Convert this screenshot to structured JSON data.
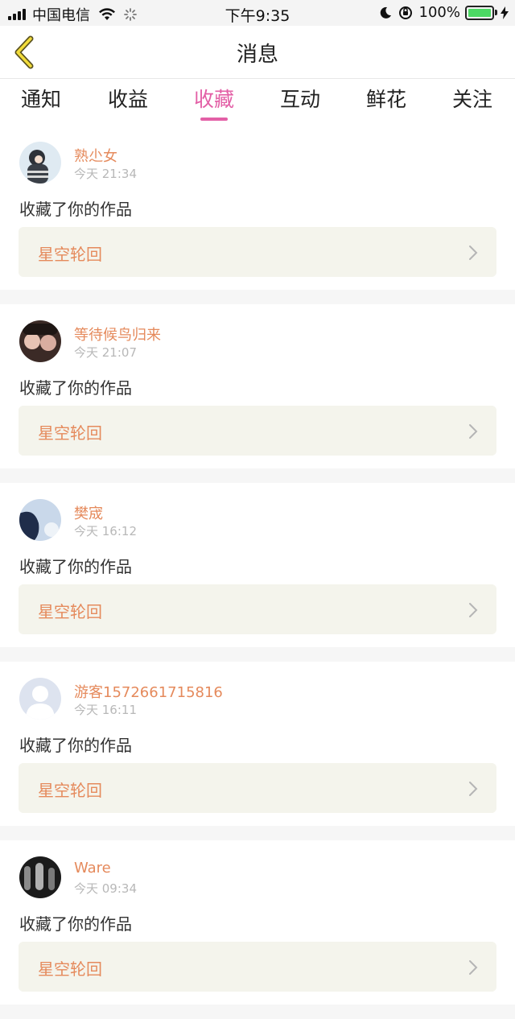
{
  "status_bar": {
    "carrier": "中国电信",
    "time": "下午9:35",
    "battery": "100%",
    "battery_level": 1.0
  },
  "header": {
    "title": "消息",
    "back_icon": "chevron-left-icon"
  },
  "tabs": [
    {
      "label": "通知",
      "active": false
    },
    {
      "label": "收益",
      "active": false
    },
    {
      "label": "收藏",
      "active": true
    },
    {
      "label": "互动",
      "active": false
    },
    {
      "label": "鲜花",
      "active": false
    },
    {
      "label": "关注",
      "active": false
    }
  ],
  "colors": {
    "accent": "#e35fa6",
    "name": "#e58a5c",
    "work_bg": "#f4f4ec"
  },
  "messages": [
    {
      "name": "熟尐女",
      "time": "今天 21:34",
      "action": "收藏了你的作品",
      "work": "星空轮回"
    },
    {
      "name": "等待候鸟归来",
      "time": "今天 21:07",
      "action": "收藏了你的作品",
      "work": "星空轮回"
    },
    {
      "name": "樊宬",
      "time": "今天 16:12",
      "action": "收藏了你的作品",
      "work": "星空轮回"
    },
    {
      "name": "游客1572661715816",
      "time": "今天 16:11",
      "action": "收藏了你的作品",
      "work": "星空轮回"
    },
    {
      "name": "Ware",
      "time": "今天 09:34",
      "action": "收藏了你的作品",
      "work": "星空轮回"
    }
  ]
}
